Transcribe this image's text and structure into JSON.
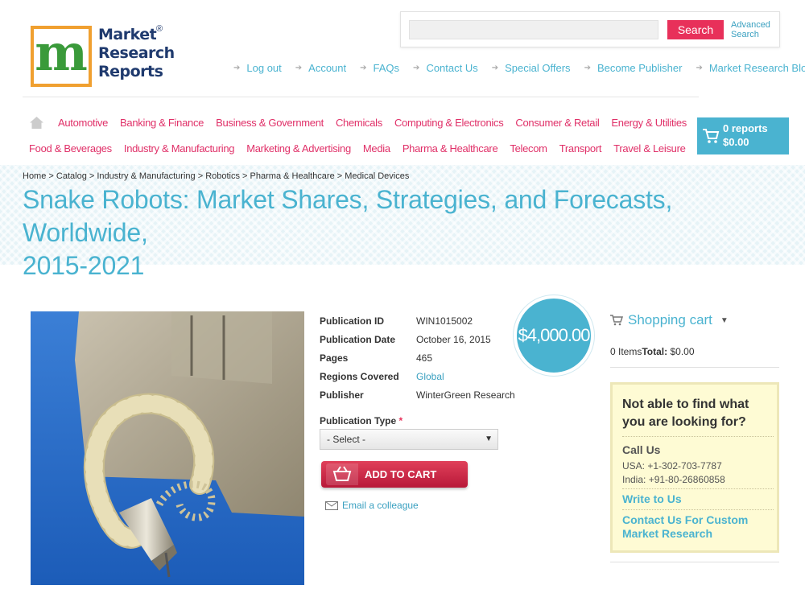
{
  "brand": {
    "logo_letter": "m",
    "logo_line1": "Market",
    "logo_line2": "Research",
    "logo_line3": "Reports",
    "registered": "®"
  },
  "search": {
    "placeholder": "",
    "button": "Search",
    "advanced_line1": "Advanced",
    "advanced_line2": "Search"
  },
  "top_links": [
    "Log out",
    "Account",
    "FAQs",
    "Contact Us",
    "Special Offers",
    "Become Publisher",
    "Market Research Blog"
  ],
  "nav_row1": [
    "Automotive",
    "Banking & Finance",
    "Business & Government",
    "Chemicals",
    "Computing & Electronics",
    "Consumer & Retail",
    "Energy & Utilities"
  ],
  "nav_row2": [
    "Food & Beverages",
    "Industry & Manufacturing",
    "Marketing & Advertising",
    "Media",
    "Pharma & Healthcare",
    "Telecom",
    "Transport",
    "Travel & Leisure"
  ],
  "cart": {
    "reports": "0 reports",
    "total": "$0.00"
  },
  "breadcrumb": [
    "Home",
    "Catalog",
    "Industry & Manufacturing",
    "Robotics",
    "Pharma & Healthcare",
    "Medical Devices"
  ],
  "breadcrumb_sep": " > ",
  "title_line1": "Snake Robots: Market Shares, Strategies, and Forecasts, Worldwide,",
  "title_line2": "2015-2021",
  "details": [
    {
      "label": "Publication ID",
      "value": "WIN1015002",
      "link": false
    },
    {
      "label": "Publication Date",
      "value": "October 16, 2015",
      "link": false
    },
    {
      "label": "Pages",
      "value": "465",
      "link": false
    },
    {
      "label": "Regions Covered",
      "value": "Global",
      "link": true
    },
    {
      "label": "Publisher",
      "value": "WinterGreen Research",
      "link": false
    }
  ],
  "price": "$4,000.00",
  "publication_type": {
    "label": "Publication Type",
    "required": "*",
    "selected": "- Select -"
  },
  "add_to_cart": "ADD TO CART",
  "email_colleague": "Email a colleague",
  "shopping_cart": {
    "title": "Shopping cart",
    "items": "0 Items",
    "total_label": "Total:",
    "total_value": "$0.00"
  },
  "help": {
    "question": "Not able to find what you are looking for?",
    "call_us": "Call Us",
    "usa": "USA: +1-302-703-7787",
    "india": "India: +91-80-26860858",
    "write": "Write to Us",
    "custom": "Contact Us For Custom Market Research"
  },
  "colors": {
    "accent": "#4ab3d0",
    "nav": "#e03068",
    "button": "#e8305a",
    "logo_border": "#f0a030"
  }
}
